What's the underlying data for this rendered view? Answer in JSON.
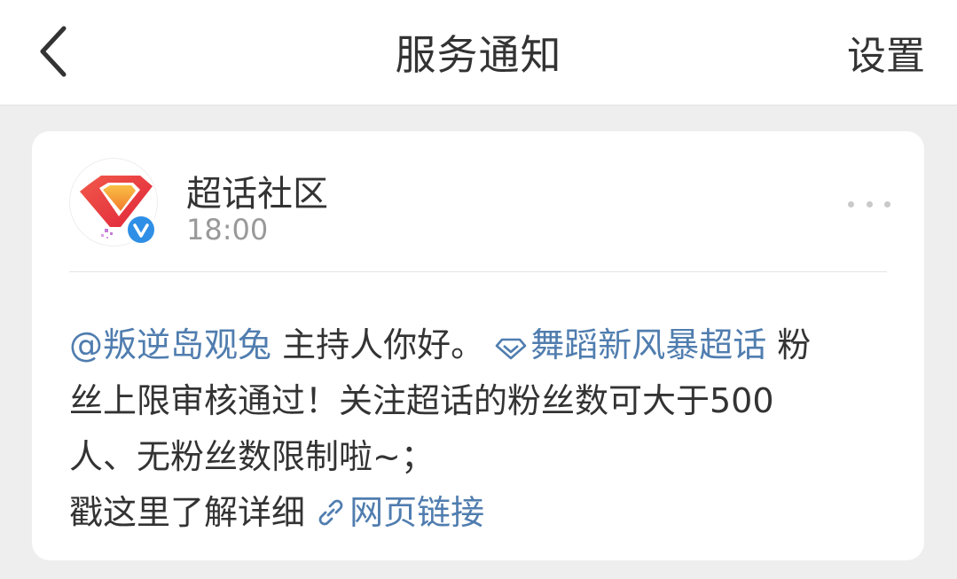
{
  "header": {
    "title": "服务通知",
    "settings_label": "设置"
  },
  "notification": {
    "sender": "超话社区",
    "time": "18:00",
    "mention": "@叛逆岛观兔",
    "greeting": " 主持人你好。",
    "topic_link": "舞蹈新风暴超话",
    "text_line1_tail": " 粉",
    "text_line2": "丝上限审核通过！关注超话的粉丝数可大于500",
    "text_line3": "人、无粉丝数限制啦~；",
    "text_line4": "戳这里了解详细 ",
    "web_link": "网页链接"
  },
  "colors": {
    "link": "#507daf",
    "verified_badge": "#2f8fe6",
    "brand_red": "#e8373d",
    "brand_orange": "#f6a23a"
  },
  "icons": {
    "back": "chevron-left-icon",
    "more": "more-dots-icon",
    "topic": "diamond-icon",
    "link": "link-icon",
    "verified": "verified-v-icon"
  }
}
